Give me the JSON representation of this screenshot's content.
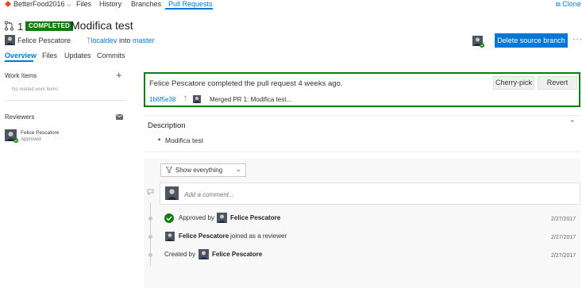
{
  "topnav": {
    "project": "BetterFood2016",
    "items": [
      "Files",
      "History",
      "Branches",
      "Pull Requests"
    ],
    "clone": "Clone"
  },
  "pr": {
    "id": "1",
    "status": "COMPLETED",
    "title": "Modifica test",
    "author": "Felice Pescatore",
    "source_branch": "localdev",
    "into": "into",
    "target_branch": "master"
  },
  "actions": {
    "delete_source": "Delete source branch",
    "more": "···"
  },
  "tabs": [
    "Overview",
    "Files",
    "Updates",
    "Commits"
  ],
  "sidebar": {
    "work_items_title": "Work Items",
    "work_items_empty": "No related work items",
    "reviewers_title": "Reviewers",
    "reviewer": {
      "name": "Felice Pescatore",
      "status": "Approved"
    }
  },
  "completed": {
    "message": "Felice Pescatore completed the pull request 4 weeks ago.",
    "commit": "1b6f5e38",
    "merge_message": "Merged PR 1: Modifica test...",
    "cherry_pick": "Cherry-pick",
    "revert": "Revert"
  },
  "description": {
    "title": "Description",
    "bullet": "Modifica test"
  },
  "activity": {
    "filter": "Show everything",
    "comment_placeholder": "Add a comment...",
    "events": [
      {
        "prefix": "Approved by",
        "name": "Felice Pescatore",
        "suffix": "",
        "date": "2/27/2017"
      },
      {
        "prefix": "",
        "name": "Felice Pescatore",
        "suffix": "joined as a reviewer",
        "date": "2/27/2017"
      },
      {
        "prefix": "Created by",
        "name": "Felice Pescatore",
        "suffix": "",
        "date": "2/27/2017"
      }
    ]
  },
  "colors": {
    "accent": "#0078d4",
    "success": "#107c10"
  }
}
